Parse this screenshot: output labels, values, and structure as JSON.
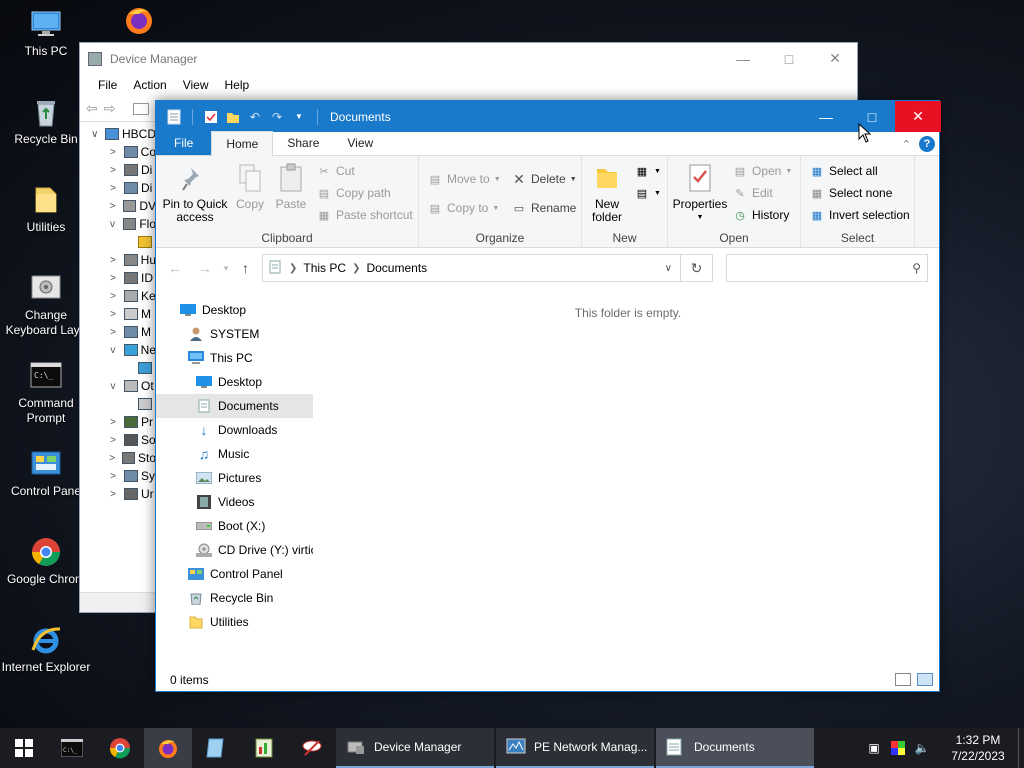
{
  "desktop": {
    "icons": [
      {
        "label": "This PC",
        "icon": "this-pc-icon"
      },
      {
        "label": "",
        "icon": "firefox-icon"
      },
      {
        "label": "Recycle Bin",
        "icon": "recycle-bin-icon"
      },
      {
        "label": "Utilities",
        "icon": "folder-icon"
      },
      {
        "label": "Change Keyboard Layo",
        "line1": "Change",
        "line2": "Keyboard Layo",
        "icon": "keyboard-layout-icon"
      },
      {
        "label": "Command Prompt",
        "line1": "Command",
        "line2": "Prompt",
        "icon": "cmd-icon"
      },
      {
        "label": "Control Pane",
        "icon": "control-panel-icon"
      },
      {
        "label": "Google Chrom",
        "icon": "chrome-icon"
      },
      {
        "label": "Internet Explorer",
        "icon": "ie-icon"
      }
    ]
  },
  "device_manager": {
    "title": "Device Manager",
    "menu": [
      "File",
      "Action",
      "View",
      "Help"
    ],
    "tree_root": "HBCD",
    "tree_rows": [
      {
        "text": "Co",
        "expander": ">"
      },
      {
        "text": "Di",
        "expander": ">"
      },
      {
        "text": "Di",
        "expander": ">"
      },
      {
        "text": "DV",
        "expander": ">"
      },
      {
        "text": "Flo",
        "expander": "v"
      },
      {
        "text": "",
        "expander": ""
      },
      {
        "text": "Hu",
        "expander": ">"
      },
      {
        "text": "ID",
        "expander": ">"
      },
      {
        "text": "Ke",
        "expander": ">"
      },
      {
        "text": "M",
        "expander": ">"
      },
      {
        "text": "M",
        "expander": ">"
      },
      {
        "text": "Ne",
        "expander": "v"
      },
      {
        "text": "",
        "expander": ""
      },
      {
        "text": "Ot",
        "expander": "v"
      },
      {
        "text": "",
        "expander": ""
      },
      {
        "text": "Pr",
        "expander": ">"
      },
      {
        "text": "So",
        "expander": ">"
      },
      {
        "text": "Sto",
        "expander": ">"
      },
      {
        "text": "Sy",
        "expander": ">"
      },
      {
        "text": "Ur",
        "expander": ">"
      }
    ]
  },
  "explorer": {
    "title": "Documents",
    "ribbon_tabs": [
      "File",
      "Home",
      "Share",
      "View"
    ],
    "active_tab": "Home",
    "clipboard": {
      "group_label": "Clipboard",
      "pin": "Pin to Quick access",
      "pin_line1": "Pin to Quick",
      "pin_line2": "access",
      "copy": "Copy",
      "paste": "Paste",
      "cut": "Cut",
      "copy_path": "Copy path",
      "paste_shortcut": "Paste shortcut"
    },
    "organize": {
      "group_label": "Organize",
      "move_to": "Move to",
      "copy_to": "Copy to",
      "delete": "Delete",
      "rename": "Rename"
    },
    "new": {
      "group_label": "New",
      "new_folder_line1": "New",
      "new_folder_line2": "folder"
    },
    "open": {
      "group_label": "Open",
      "properties": "Properties",
      "open": "Open",
      "edit": "Edit",
      "history": "History"
    },
    "select": {
      "group_label": "Select",
      "select_all": "Select all",
      "select_none": "Select none",
      "invert": "Invert selection"
    },
    "address": {
      "crumbs": [
        "This PC",
        "Documents"
      ]
    },
    "search": {
      "placeholder": ""
    },
    "nav_pane": [
      {
        "label": "Desktop",
        "indent": 0,
        "icon": "desktop-icon"
      },
      {
        "label": "SYSTEM",
        "indent": 1,
        "icon": "user-icon"
      },
      {
        "label": "This PC",
        "indent": 1,
        "icon": "this-pc-icon"
      },
      {
        "label": "Desktop",
        "indent": 2,
        "icon": "desktop-icon"
      },
      {
        "label": "Documents",
        "indent": 2,
        "icon": "documents-icon",
        "selected": true
      },
      {
        "label": "Downloads",
        "indent": 2,
        "icon": "downloads-icon"
      },
      {
        "label": "Music",
        "indent": 2,
        "icon": "music-icon"
      },
      {
        "label": "Pictures",
        "indent": 2,
        "icon": "pictures-icon"
      },
      {
        "label": "Videos",
        "indent": 2,
        "icon": "videos-icon"
      },
      {
        "label": "Boot (X:)",
        "indent": 2,
        "icon": "drive-icon"
      },
      {
        "label": "CD Drive (Y:) virtic",
        "indent": 2,
        "icon": "cd-drive-icon"
      },
      {
        "label": "Control Panel",
        "indent": 1,
        "icon": "control-panel-icon"
      },
      {
        "label": "Recycle Bin",
        "indent": 1,
        "icon": "recycle-bin-icon"
      },
      {
        "label": "Utilities",
        "indent": 1,
        "icon": "folder-icon"
      }
    ],
    "empty_message": "This folder is empty.",
    "status": "0 items"
  },
  "taskbar": {
    "pinned": [
      "cmd-icon",
      "chrome-icon",
      "firefox-icon",
      "notepad-icon",
      "registry-icon",
      "tools-icon"
    ],
    "tasks": [
      {
        "label": "Device Manager",
        "icon": "device-manager-icon"
      },
      {
        "label": "PE Network Manag...",
        "icon": "network-manager-icon"
      },
      {
        "label": "Documents",
        "icon": "documents-icon",
        "active": true
      }
    ],
    "clock_time": "1:32 PM",
    "clock_date": "7/22/2023"
  },
  "colors": {
    "accent": "#1979ca",
    "close_red": "#e81123",
    "taskbar_bg": "#1a1c22"
  }
}
